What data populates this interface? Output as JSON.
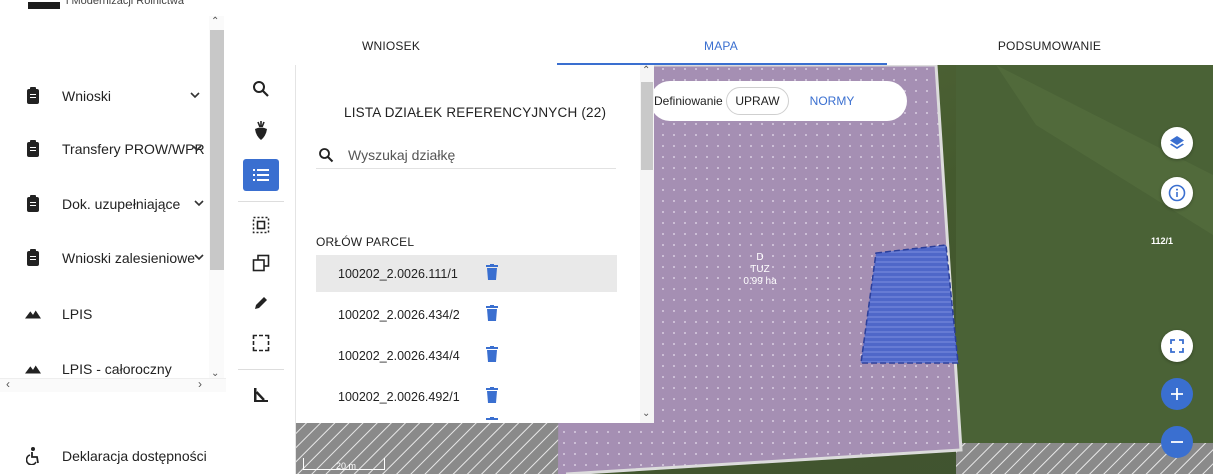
{
  "brand": {
    "text": "i Modernizacji Rolnictwa"
  },
  "sidebar": {
    "items": [
      {
        "label": "Wnioski",
        "icon": "clipboard-icon",
        "has_chevron": true
      },
      {
        "label": "Transfery PROW/WPR",
        "icon": "clipboard-icon",
        "has_chevron": true
      },
      {
        "label": "Dok. uzupełniające",
        "icon": "clipboard-icon",
        "has_chevron": true
      },
      {
        "label": "Wnioski zalesieniowe",
        "icon": "clipboard-icon",
        "has_chevron": true
      },
      {
        "label": "LPIS",
        "icon": "mountain-icon",
        "has_chevron": false
      },
      {
        "label": "LPIS - całoroczny",
        "icon": "mountain-icon",
        "has_chevron": false
      }
    ],
    "footer": {
      "label": "Deklaracja dostępności",
      "icon": "accessibility-icon"
    }
  },
  "tabs": [
    {
      "label": "WNIOSEK",
      "active": false
    },
    {
      "label": "MAPA",
      "active": true
    },
    {
      "label": "PODSUMOWANIE",
      "active": false
    }
  ],
  "tools": [
    {
      "name": "search-tool",
      "icon": "search-icon",
      "active": false
    },
    {
      "name": "crop-tool",
      "icon": "beet-icon",
      "active": false
    },
    {
      "name": "list-tool",
      "icon": "list-icon",
      "active": true
    },
    {
      "name": "select-area-tool",
      "icon": "select-area-icon",
      "active": false
    },
    {
      "name": "copy-tool",
      "icon": "copy-icon",
      "active": false
    },
    {
      "name": "edit-tool",
      "icon": "pencil-icon",
      "active": false
    },
    {
      "name": "draw-rectangle-tool",
      "icon": "rectangle-select-icon",
      "active": false
    },
    {
      "name": "measure-tool",
      "icon": "ruler-angle-icon",
      "active": false
    }
  ],
  "panel": {
    "title": "LISTA DZIAŁEK REFERENCYJNYCH (22)",
    "search": {
      "placeholder": "Wyszukaj działkę",
      "value": ""
    },
    "group_label": "ORŁÓW PARCEL",
    "parcels": [
      {
        "id": "100202_2.0026.111/1",
        "selected": true
      },
      {
        "id": "100202_2.0026.434/2",
        "selected": false
      },
      {
        "id": "100202_2.0026.434/4",
        "selected": false
      },
      {
        "id": "100202_2.0026.492/1",
        "selected": false
      }
    ]
  },
  "map": {
    "define_label": "Definiowanie",
    "segment_upraw": "UPRAW",
    "segment_normy": "NORMY",
    "parcel_label": {
      "line1": "D",
      "line2": "TUZ",
      "line3": "0.99 ha"
    },
    "plot_id": "112/1",
    "scale": "20 m"
  },
  "colors": {
    "accent": "#3a6fd0",
    "parcel_fill": "#a58fb3",
    "selection_fill": "#4f67c9"
  }
}
